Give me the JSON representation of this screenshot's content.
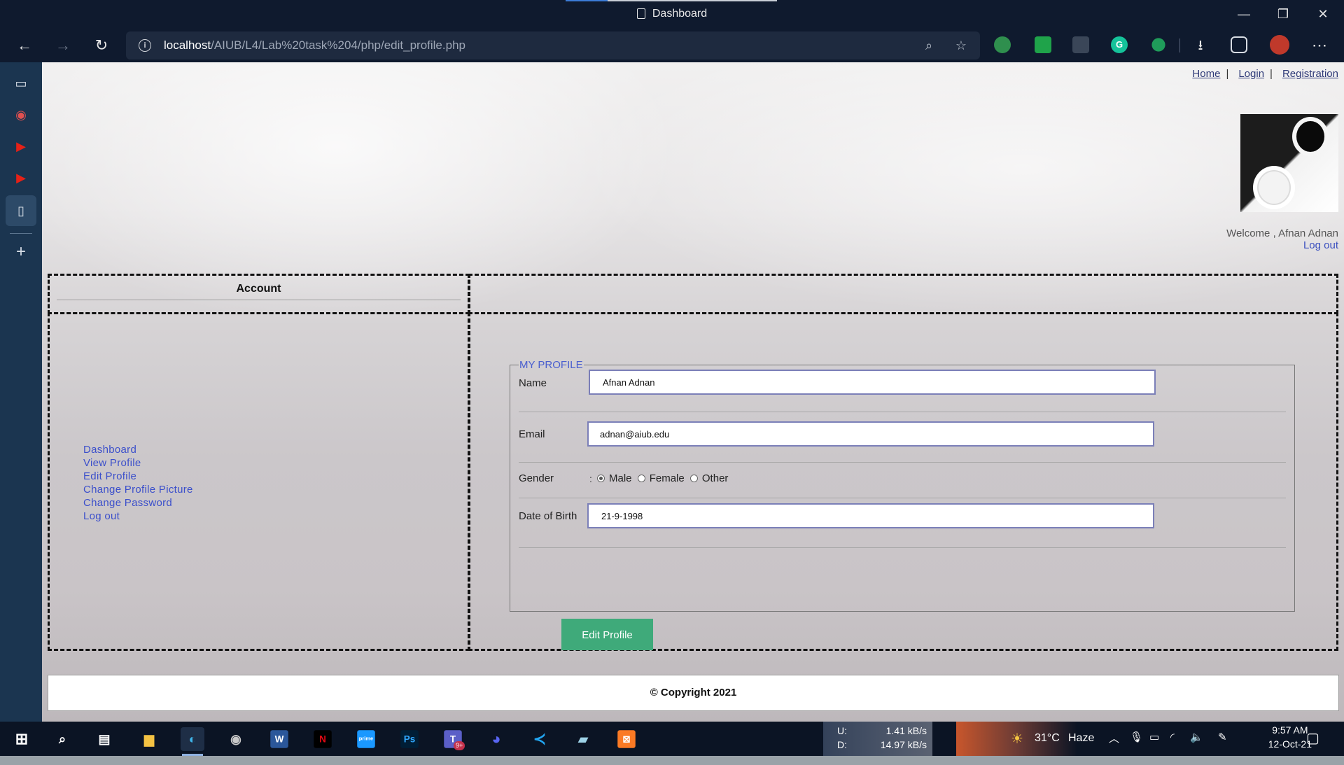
{
  "browser": {
    "tab_title": "Dashboard",
    "url_host": "localhost",
    "url_path": "/AIUB/L4/Lab%20task%204/php/edit_profile.php"
  },
  "icons": {
    "back": "←",
    "forward": "→",
    "reload": "↻",
    "info": "i",
    "zoom": "⌕",
    "favorite": "☆",
    "downloads": "⭳",
    "more": "⋯",
    "minimize": "—",
    "restore": "❐",
    "close": "✕"
  },
  "nav_links": {
    "home": "Home",
    "login": "Login",
    "registration": "Registration",
    "separator": "|"
  },
  "welcome": {
    "text": "Welcome , Afnan Adnan",
    "logout": "Log out"
  },
  "account_header": "Account",
  "menu": {
    "items": [
      "Dashboard",
      "View Profile",
      "Edit Profile",
      "Change Profile Picture",
      "Change Password",
      "Log out"
    ]
  },
  "profile": {
    "legend": "MY PROFILE",
    "name_label": "Name",
    "name_value": "Afnan Adnan",
    "email_label": "Email",
    "email_value": "adnan@aiub.edu",
    "gender_label": "Gender",
    "gender_options": [
      "Male",
      "Female",
      "Other"
    ],
    "gender_selected": "Male",
    "dob_label": "Date of Birth",
    "dob_value": "21-9-1998",
    "colon": ":",
    "button": "Edit Profile"
  },
  "footer": "© Copyright 2021",
  "taskbar": {
    "net_upload_label": "U:",
    "net_upload": "1.41 kB/s",
    "net_download_label": "D:",
    "net_download": "14.97 kB/s",
    "temperature": "31°C",
    "weather": "Haze",
    "time": "9:57 AM",
    "date": "12-Oct-21",
    "teams_badge": "9+"
  },
  "colors": {
    "link": "#3b4fcb",
    "button": "#3faa7a",
    "chrome": "#0f1a2e"
  }
}
